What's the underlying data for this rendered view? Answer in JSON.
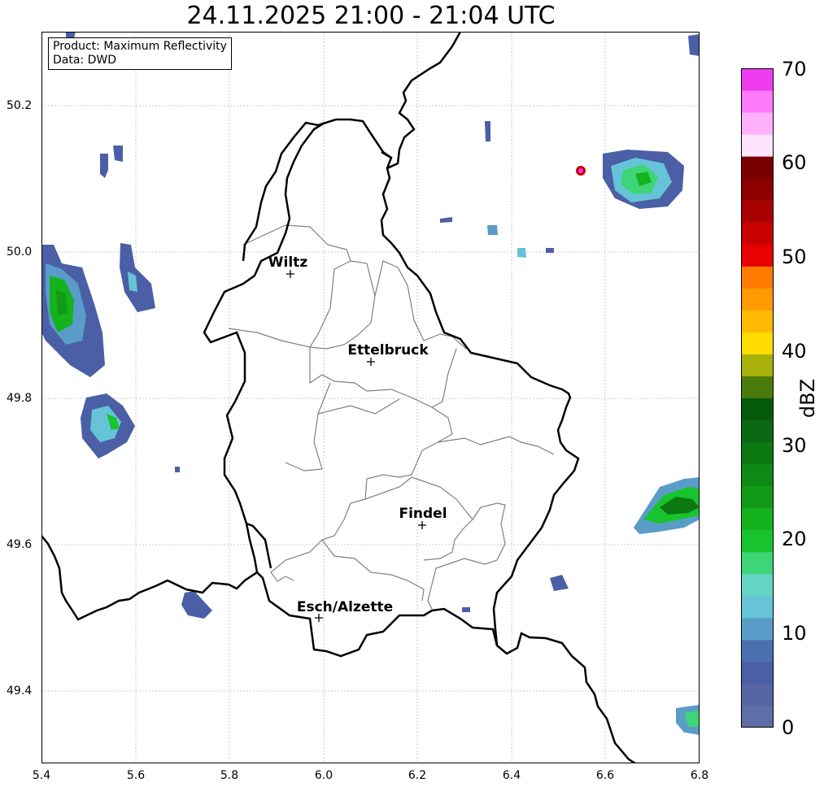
{
  "title": "24.11.2025 21:00 - 21:04 UTC",
  "info": {
    "product": "Product: Maximum Reflectivity",
    "data": "Data: DWD"
  },
  "axes": {
    "x_ticks": [
      "5.4",
      "5.6",
      "5.8",
      "6.0",
      "6.2",
      "6.4",
      "6.6",
      "6.8"
    ],
    "y_ticks": [
      "50.2",
      "50.0",
      "49.8",
      "49.6",
      "49.4"
    ]
  },
  "colorbar": {
    "label": "dBZ",
    "ticks": [
      "0",
      "10",
      "20",
      "30",
      "40",
      "50",
      "60",
      "70"
    ],
    "colors": [
      "#5f6ea6",
      "#5666a4",
      "#4a5fa6",
      "#4a70b0",
      "#5a9cc8",
      "#66c3d8",
      "#64d4c4",
      "#3ed478",
      "#17c42e",
      "#14b31e",
      "#129a16",
      "#0d8a13",
      "#0b7812",
      "#0a6812",
      "#045a0a",
      "#4a7a0b",
      "#a8b00a",
      "#ffdb00",
      "#ffb900",
      "#ff9a00",
      "#ff7c00",
      "#e60000",
      "#c80000",
      "#a80000",
      "#8c0000",
      "#7a0000",
      "#ffe4fb",
      "#ffb2fa",
      "#ff7af8",
      "#f03cf0"
    ]
  },
  "cities": [
    {
      "name": "Wiltz"
    },
    {
      "name": "Ettelbruck"
    },
    {
      "name": "Findel"
    },
    {
      "name": "Esch/Alzette"
    }
  ]
}
